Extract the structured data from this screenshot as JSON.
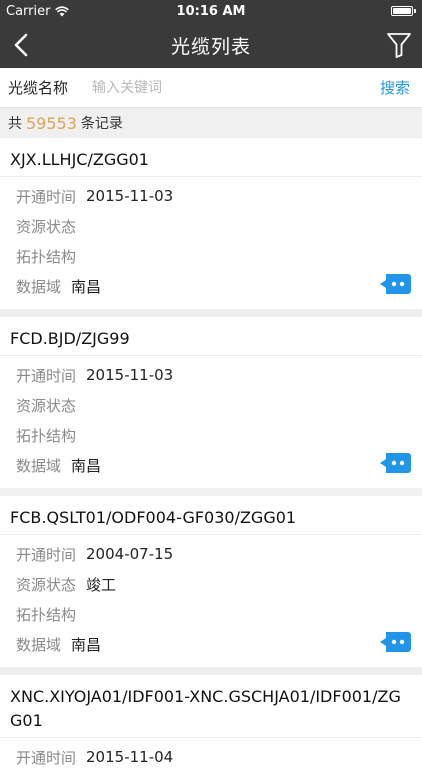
{
  "status": {
    "carrier": "Carrier",
    "time": "10:16 AM"
  },
  "nav": {
    "title": "光缆列表"
  },
  "search": {
    "label": "光缆名称",
    "placeholder": "输入关键词",
    "value": "",
    "button": "搜索"
  },
  "summary": {
    "prefix": "共",
    "count": "59553",
    "suffix": "条记录"
  },
  "colors": {
    "accent": "#2196e8",
    "count": "#d8a657",
    "bar": "#3a3a3a"
  },
  "cards": [
    {
      "name": "XJX.LLHJC/ZGG01",
      "fields": [
        {
          "label": "开通时间",
          "value": "2015-11-03"
        },
        {
          "label": "资源状态",
          "value": ""
        },
        {
          "label": "拓扑结构",
          "value": ""
        },
        {
          "label": "数据域",
          "value": "南昌"
        }
      ]
    },
    {
      "name": "FCD.BJD/ZJG99",
      "fields": [
        {
          "label": "开通时间",
          "value": "2015-11-03"
        },
        {
          "label": "资源状态",
          "value": ""
        },
        {
          "label": "拓扑结构",
          "value": ""
        },
        {
          "label": "数据域",
          "value": "南昌"
        }
      ]
    },
    {
      "name": "FCB.QSLT01/ODF004-GF030/ZGG01",
      "fields": [
        {
          "label": "开通时间",
          "value": "2004-07-15"
        },
        {
          "label": "资源状态",
          "value": "竣工"
        },
        {
          "label": "拓扑结构",
          "value": ""
        },
        {
          "label": "数据域",
          "value": "南昌"
        }
      ]
    },
    {
      "name": "XNC.XIYOJA01/IDF001-XNC.GSCHJA01/IDF001/ZGG01",
      "fields": [
        {
          "label": "开通时间",
          "value": "2015-11-04"
        }
      ]
    }
  ]
}
